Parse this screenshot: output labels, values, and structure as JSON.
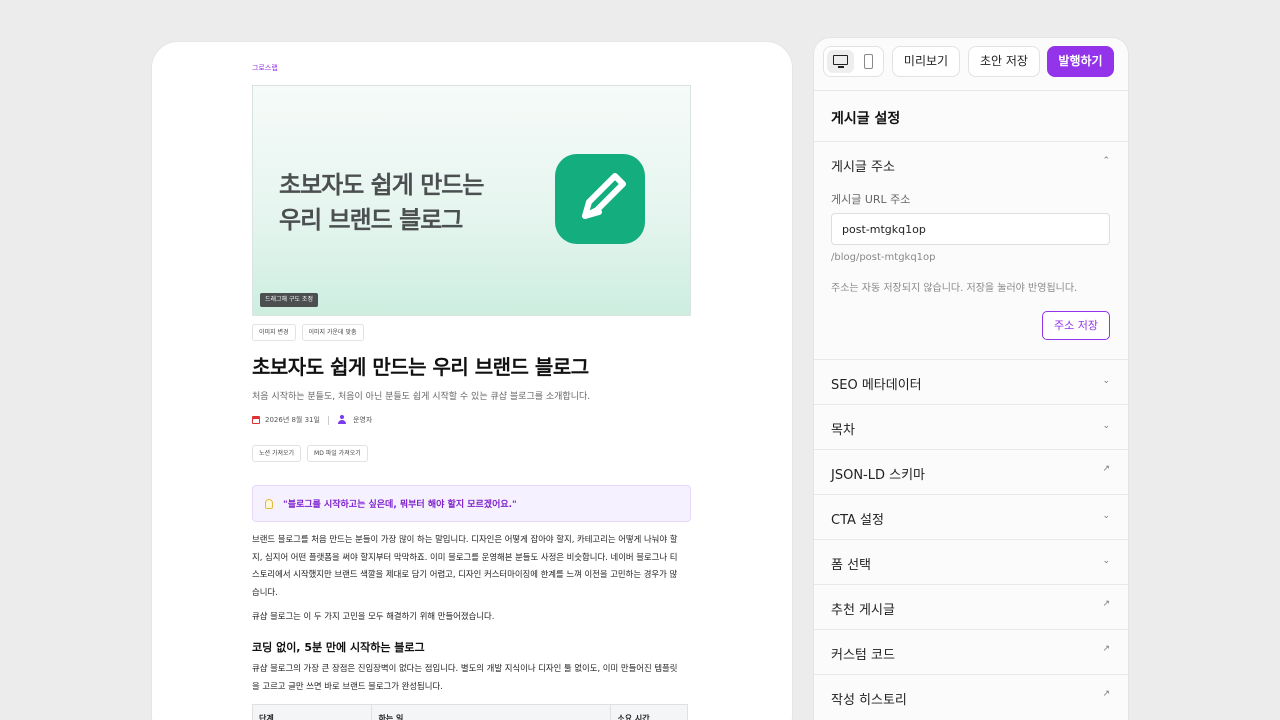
{
  "editor": {
    "category": "그로스랩",
    "cover": {
      "title_line1": "초보자도 쉽게 만드는",
      "title_line2": "우리 브랜드 블로그",
      "drag_badge": "드래그해 구도 조정",
      "icon": "pencil-square-icon",
      "brand_color": "#14ad7d"
    },
    "image_actions": [
      "이미지 변경",
      "이미지 가운데 맞춤"
    ],
    "title": "초보자도 쉽게 만드는 우리 브랜드 블로그",
    "summary": "처음 시작하는 분들도, 처음이 아닌 분들도 쉽게 시작할 수 있는 큐샵 블로그를 소개합니다.",
    "date": "2026년 8월 31일",
    "author": "운영자",
    "import_actions": [
      "노션 가져오기",
      "MD 파일 가져오기"
    ],
    "callout": "\"블로그를 시작하고는 싶은데, 뭐부터 해야 할지 모르겠어요.\"",
    "paragraph1": "브랜드 블로그를 처음 만드는 분들이 가장 많이 하는 말입니다. 디자인은 어떻게 잡아야 할지, 카테고리는 어떻게 나눠야 할지, 심지어 어떤 플랫폼을 써야 할지부터 막막하죠. 이미 블로그를 운영해본 분들도 사정은 비슷합니다. 네이버 블로그나 티스토리에서 시작했지만 브랜드 색깔을 제대로 담기 어렵고, 디자인 커스터마이징에 한계를 느껴 이전을 고민하는 경우가 많습니다.",
    "paragraph2": "큐샵 블로그는 이 두 가지 고민을 모두 해결하기 위해 만들어졌습니다.",
    "subheading": "코딩 없이, 5분 만에 시작하는 블로그",
    "paragraph3": "큐샵 블로그의 가장 큰 장점은 진입장벽이 없다는 점입니다. 별도의 개발 지식이나 디자인 툴 없이도, 이미 만들어진 템플릿을 고르고 글만 쓰면 바로 브랜드 블로그가 완성됩니다.",
    "table_headers": [
      "단계",
      "하는 일",
      "소요 시간"
    ]
  },
  "toolbar": {
    "preview": "미리보기",
    "save_draft": "초안 저장",
    "publish": "발행하기",
    "accent": "#9333ea"
  },
  "settings": {
    "title": "게시글 설정",
    "address_section": {
      "label": "게시글 주소",
      "url_label": "게시글 URL 주소",
      "url_value": "post-mtgkq1op",
      "path": "/blog/post-mtgkq1op",
      "note": "주소는 자동 저장되지 않습니다. 저장을 눌러야 반영됩니다.",
      "save_button": "주소 저장"
    },
    "sections": [
      {
        "label": "SEO 메타데이터",
        "icon": "chevron-down-icon",
        "glyph": "⌄"
      },
      {
        "label": "목차",
        "icon": "chevron-down-icon",
        "glyph": "⌄"
      },
      {
        "label": "JSON-LD 스키마",
        "icon": "arrow-up-right-icon",
        "glyph": "↗"
      },
      {
        "label": "CTA 설정",
        "icon": "chevron-down-icon",
        "glyph": "⌄"
      },
      {
        "label": "폼 선택",
        "icon": "chevron-down-icon",
        "glyph": "⌄"
      },
      {
        "label": "추천 게시글",
        "icon": "arrow-up-right-icon",
        "glyph": "↗"
      },
      {
        "label": "커스텀 코드",
        "icon": "arrow-up-right-icon",
        "glyph": "↗"
      },
      {
        "label": "작성 히스토리",
        "icon": "arrow-up-right-icon",
        "glyph": "↗"
      }
    ]
  }
}
